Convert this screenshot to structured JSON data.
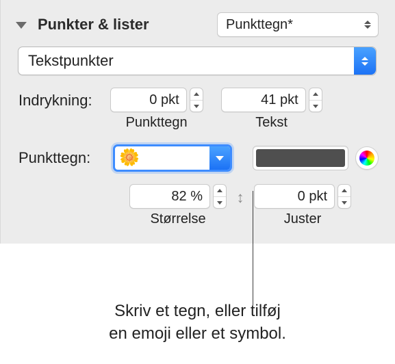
{
  "header": {
    "title": "Punkter & lister",
    "style_popup": "Punkttegn*"
  },
  "bullet_type_popup": "Tekstpunkter",
  "indent": {
    "label": "Indrykning:",
    "bullet_value": "0 pkt",
    "bullet_caption": "Punkttegn",
    "text_value": "41 pkt",
    "text_caption": "Tekst"
  },
  "bullet_char": {
    "label": "Punkttegn:",
    "glyph": "🌼",
    "color": "#4f4f4f"
  },
  "size_align": {
    "size_value": "82 %",
    "size_caption": "Størrelse",
    "align_value": "0 pkt",
    "align_caption": "Juster"
  },
  "callout_line1": "Skriv et tegn, eller tilføj",
  "callout_line2": "en emoji eller et symbol."
}
